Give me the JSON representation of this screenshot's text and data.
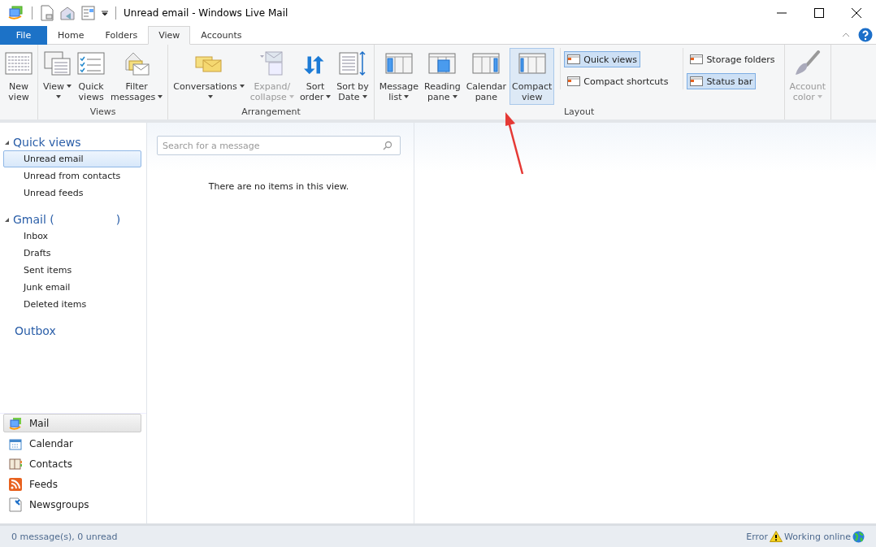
{
  "window": {
    "title": "Unread email - Windows Live Mail"
  },
  "tabs": [
    {
      "label": "File",
      "kind": "file",
      "selected": false
    },
    {
      "label": "Home",
      "kind": "tab",
      "selected": false
    },
    {
      "label": "Folders",
      "kind": "tab",
      "selected": false
    },
    {
      "label": "View",
      "kind": "tab",
      "selected": true
    },
    {
      "label": "Accounts",
      "kind": "tab",
      "selected": false
    }
  ],
  "ribbon": {
    "groups": [
      {
        "buttons": [
          {
            "lines": [
              "New",
              "view"
            ],
            "kind": "grid",
            "dropdown": false,
            "disabled": false,
            "selected": false
          }
        ]
      },
      {
        "label": "Views",
        "buttons": [
          {
            "lines": [
              "View"
            ],
            "kind": "stack",
            "dropdown": true,
            "disabled": false,
            "selected": false
          },
          {
            "lines": [
              "Quick",
              "views"
            ],
            "kind": "checklist",
            "dropdown": false,
            "disabled": false,
            "selected": false
          },
          {
            "lines": [
              "Filter",
              "messages"
            ],
            "kind": "envelopes",
            "dropdown": true,
            "disabled": false,
            "selected": false
          }
        ]
      },
      {
        "label": "Arrangement",
        "buttons": [
          {
            "lines": [
              "Conversations"
            ],
            "kind": "envelopes2",
            "dropdown": true,
            "disabled": false,
            "selected": false
          },
          {
            "lines": [
              "Expand/",
              "collapse"
            ],
            "kind": "expand",
            "dropdown": true,
            "disabled": true,
            "selected": false
          },
          {
            "lines": [
              "Sort",
              "order"
            ],
            "kind": "sort",
            "dropdown": true,
            "disabled": false,
            "selected": false
          },
          {
            "lines": [
              "Sort by",
              "Date"
            ],
            "kind": "sortdate",
            "dropdown": true,
            "disabled": false,
            "selected": false
          }
        ]
      },
      {
        "label": "Layout",
        "buttons": [
          {
            "lines": [
              "Message",
              "list"
            ],
            "kind": "pane-left",
            "dropdown": true,
            "disabled": false,
            "selected": false
          },
          {
            "lines": [
              "Reading",
              "pane"
            ],
            "kind": "pane-center",
            "dropdown": true,
            "disabled": false,
            "selected": false
          },
          {
            "lines": [
              "Calendar",
              "pane"
            ],
            "kind": "pane-right",
            "dropdown": false,
            "disabled": false,
            "selected": false
          },
          {
            "lines": [
              "Compact",
              "view"
            ],
            "kind": "pane-thin",
            "dropdown": false,
            "disabled": false,
            "selected": true
          }
        ],
        "toggles": [
          [
            {
              "label": "Quick views",
              "selected": true
            },
            {
              "label": "Compact shortcuts",
              "selected": false
            }
          ],
          [
            {
              "label": "Storage folders",
              "selected": false
            },
            {
              "label": "Status bar",
              "selected": true
            }
          ]
        ]
      },
      {
        "buttons": [
          {
            "lines": [
              "Account",
              "color"
            ],
            "kind": "brush",
            "dropdown": true,
            "disabled": true,
            "selected": false
          }
        ]
      }
    ]
  },
  "folders": [
    {
      "title": "Quick views",
      "expanded": true,
      "items": [
        {
          "label": "Unread email",
          "selected": true
        },
        {
          "label": "Unread from contacts",
          "selected": false
        },
        {
          "label": "Unread feeds",
          "selected": false
        }
      ]
    },
    {
      "title": "Gmail (",
      "suffix": ")",
      "expanded": true,
      "items": [
        {
          "label": "Inbox",
          "selected": false
        },
        {
          "label": "Drafts",
          "selected": false
        },
        {
          "label": "Sent items",
          "selected": false
        },
        {
          "label": "Junk email",
          "selected": false
        },
        {
          "label": "Deleted items",
          "selected": false
        }
      ]
    }
  ],
  "outbox": "Outbox",
  "modules": [
    {
      "label": "Mail",
      "kind": "mail",
      "selected": true
    },
    {
      "label": "Calendar",
      "kind": "calendar",
      "selected": false
    },
    {
      "label": "Contacts",
      "kind": "contacts",
      "selected": false
    },
    {
      "label": "Feeds",
      "kind": "feeds",
      "selected": false
    },
    {
      "label": "Newsgroups",
      "kind": "news",
      "selected": false
    }
  ],
  "search": {
    "placeholder": "Search for a message"
  },
  "empty_message": "There are no items in this view.",
  "status_bar": {
    "summary": "0 message(s), 0 unread",
    "error": "Error",
    "connection": "Working online"
  }
}
